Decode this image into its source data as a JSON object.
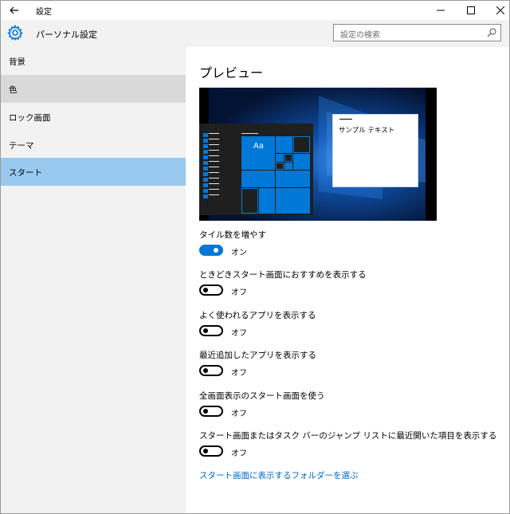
{
  "window": {
    "title": "設定",
    "back_icon": "back-arrow-icon",
    "minimize_icon": "minimize-icon",
    "maximize_icon": "maximize-icon",
    "close_icon": "close-icon"
  },
  "header": {
    "title": "パーソナル設定",
    "gear_icon": "gear-icon",
    "accent_color": "#0078d7",
    "search": {
      "placeholder": "設定の検索",
      "icon": "search-icon"
    }
  },
  "sidebar": {
    "items": [
      {
        "label": "背景",
        "state": "normal"
      },
      {
        "label": "色",
        "state": "hover"
      },
      {
        "label": "ロック画面",
        "state": "normal"
      },
      {
        "label": "テーマ",
        "state": "normal"
      },
      {
        "label": "スタート",
        "state": "selected"
      }
    ],
    "selected_color": "#99c9ef",
    "hover_color": "#d9d9d9"
  },
  "main": {
    "preview_title": "プレビュー",
    "preview": {
      "tile_text": "Aa",
      "window_text": "サンプル テキスト"
    },
    "settings": [
      {
        "label": "タイル数を増やす",
        "on": true,
        "state_text": "オン"
      },
      {
        "label": "ときどきスタート画面におすすめを表示する",
        "on": false,
        "state_text": "オフ"
      },
      {
        "label": "よく使われるアプリを表示する",
        "on": false,
        "state_text": "オフ"
      },
      {
        "label": "最近追加したアプリを表示する",
        "on": false,
        "state_text": "オフ"
      },
      {
        "label": "全画面表示のスタート画面を使う",
        "on": false,
        "state_text": "オフ"
      },
      {
        "label": "スタート画面またはタスク バーのジャンプ リストに最近開いた項目を表示する",
        "on": false,
        "state_text": "オフ"
      }
    ],
    "link_text": "スタート画面に表示するフォルダーを選ぶ",
    "link_color": "#0067c0"
  }
}
